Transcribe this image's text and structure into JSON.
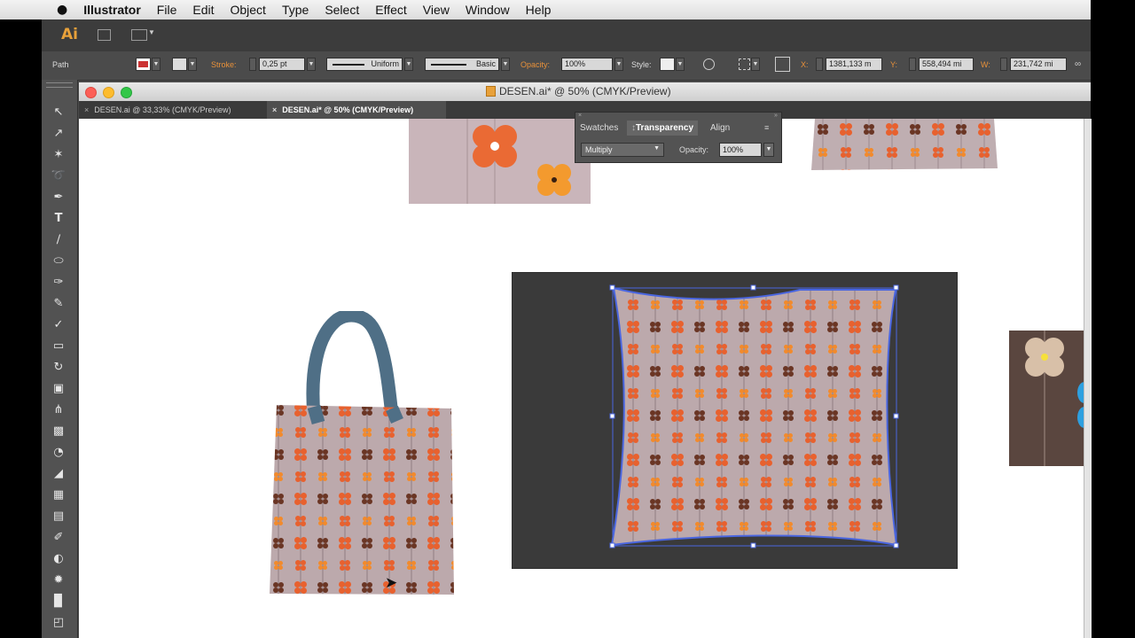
{
  "menu_bar": {
    "apple": "",
    "app_name": "Illustrator",
    "items": [
      "File",
      "Edit",
      "Object",
      "Type",
      "Select",
      "Effect",
      "View",
      "Window",
      "Help"
    ]
  },
  "app_bar": {
    "logo": "Ai"
  },
  "control_bar": {
    "selection_type": "Path",
    "stroke_label": "Stroke:",
    "stroke_weight": "0,25 pt",
    "profile": "Uniform",
    "brush": "Basic",
    "opacity_label": "Opacity:",
    "opacity_value": "100%",
    "style_label": "Style:",
    "x_label": "X:",
    "x_value": "1381,133 m",
    "y_label": "Y:",
    "y_value": "558,494 mi",
    "w_label": "W:",
    "w_value": "231,742 mi",
    "fill_color": "#cc3333",
    "accent_color": "#e8913a"
  },
  "document": {
    "title": "DESEN.ai* @ 50% (CMYK/Preview)",
    "tabs": [
      {
        "label": "DESEN.ai @ 33,33% (CMYK/Preview)",
        "active": false
      },
      {
        "label": "DESEN.ai* @ 50% (CMYK/Preview)",
        "active": true
      }
    ]
  },
  "transparency_panel": {
    "tabs": [
      "Swatches",
      "Transparency",
      "Align"
    ],
    "active_tab": "Transparency",
    "blend_mode": "Multiply",
    "opacity_label": "Opacity:",
    "opacity_value": "100%"
  },
  "tools": [
    "selection-tool",
    "direct-selection-tool",
    "magic-wand-tool",
    "lasso-tool",
    "pen-tool",
    "type-tool",
    "line-tool",
    "ellipse-tool",
    "paintbrush-tool",
    "pencil-tool",
    "blob-brush-tool",
    "eraser-tool",
    "rotate-tool",
    "scale-tool",
    "width-tool",
    "free-transform-tool",
    "shape-builder-tool",
    "perspective-grid-tool",
    "mesh-tool",
    "gradient-tool",
    "eyedropper-tool",
    "blend-tool",
    "symbol-sprayer-tool",
    "column-graph-tool",
    "artboard-tool"
  ],
  "colors": {
    "flower_orange": "#e8612e",
    "flower_light_orange": "#f28a2c",
    "flower_brown": "#6a3524",
    "fabric_mauve": "#bfaeb1",
    "selection_blue": "#4a66e0",
    "bag_handle": "#4f6f86",
    "photo_background": "#3a3a3a",
    "swatch_brown": "#5a463f",
    "swatch_beige": "#d8c0a8"
  }
}
